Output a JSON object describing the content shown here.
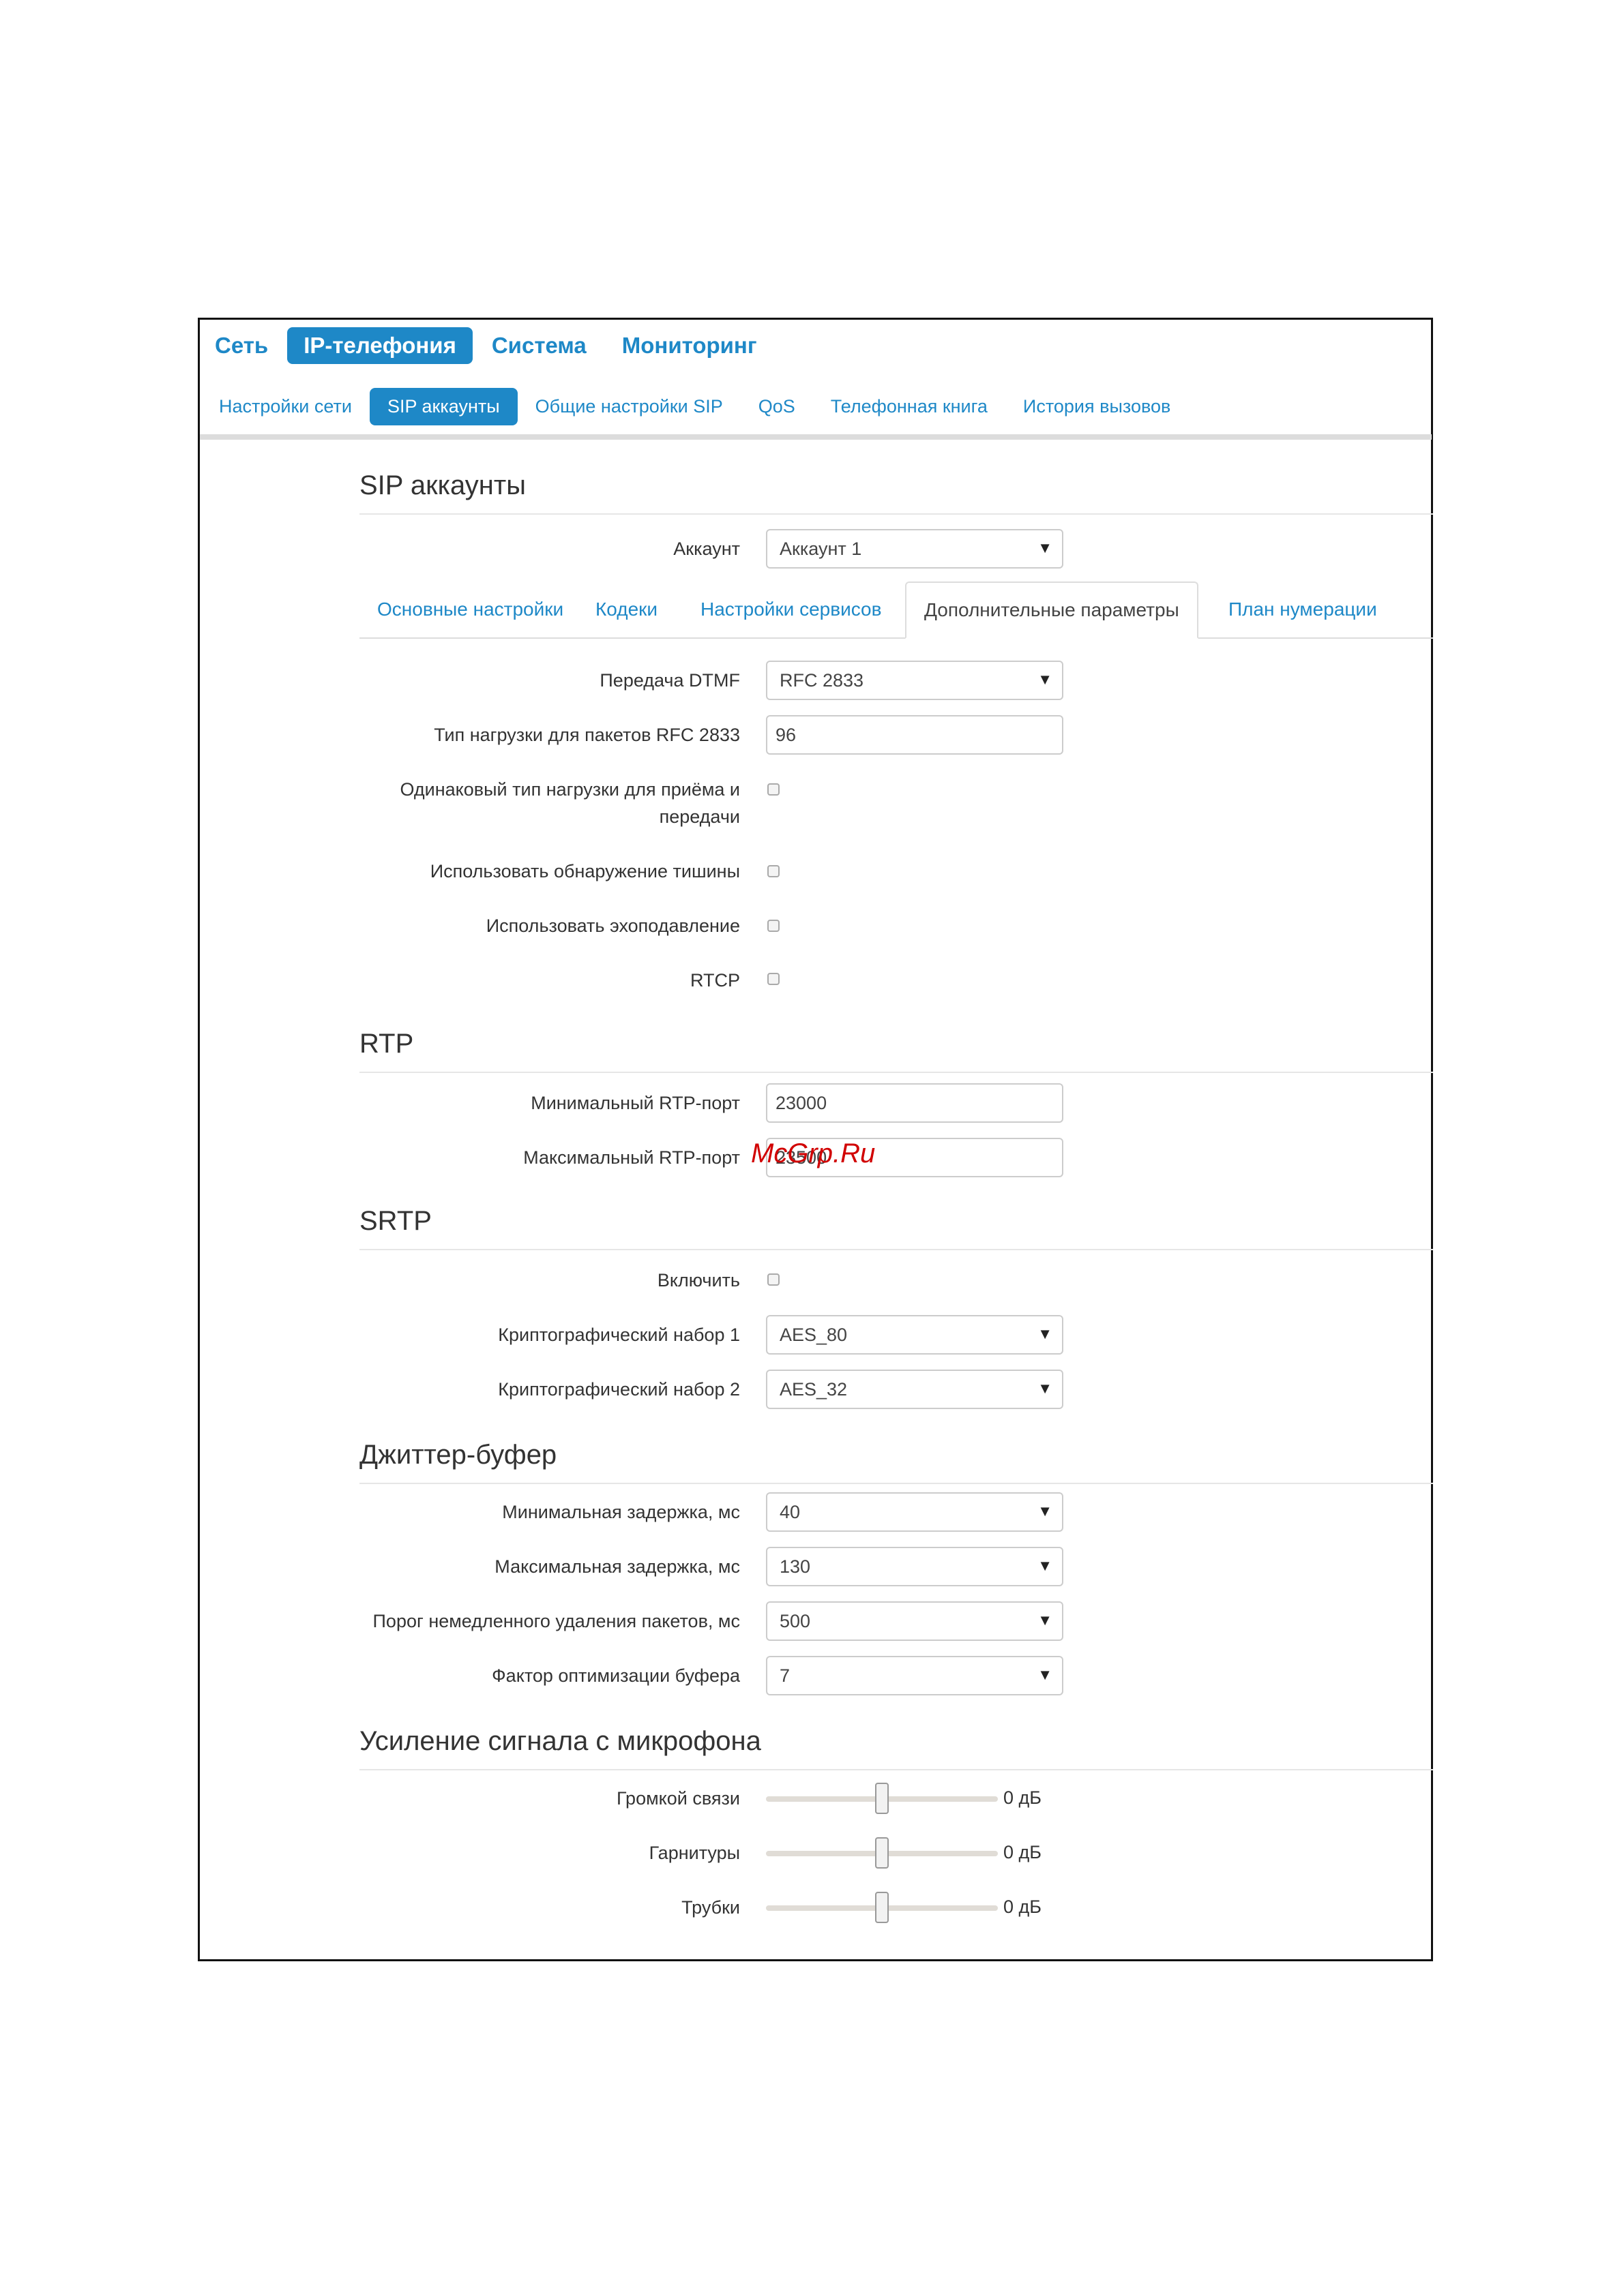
{
  "main_nav": [
    "Сеть",
    "IP-телефония",
    "Система",
    "Мониторинг"
  ],
  "sub_nav": [
    "Настройки сети",
    "SIP аккаунты",
    "Общие настройки SIP",
    "QoS",
    "Телефонная книга",
    "История вызовов"
  ],
  "page_title": "SIP аккаунты",
  "account": {
    "label": "Аккаунт",
    "value": "Аккаунт 1"
  },
  "tabs": [
    "Основные настройки",
    "Кодеки",
    "Настройки сервисов",
    "Дополнительные параметры",
    "План нумерации"
  ],
  "additional": {
    "dtmf": {
      "label": "Передача DTMF",
      "value": "RFC 2833"
    },
    "payload": {
      "label": "Тип нагрузки для пакетов RFC 2833",
      "value": "96"
    },
    "same_payload": {
      "label": "Одинаковый тип нагрузки для приёма и передачи",
      "checked": false
    },
    "vad": {
      "label": "Использовать обнаружение тишины",
      "checked": false
    },
    "echo": {
      "label": "Использовать эхоподавление",
      "checked": false
    },
    "rtcp": {
      "label": "RTCP",
      "checked": false
    }
  },
  "rtp": {
    "title": "RTP",
    "min_port": {
      "label": "Минимальный RTP-порт",
      "value": "23000"
    },
    "max_port": {
      "label": "Максимальный RTP-порт",
      "value": "23500"
    }
  },
  "srtp": {
    "title": "SRTP",
    "enable": {
      "label": "Включить",
      "checked": false
    },
    "crypto1": {
      "label": "Криптографический набор 1",
      "value": "AES_80"
    },
    "crypto2": {
      "label": "Криптографический набор 2",
      "value": "AES_32"
    }
  },
  "jitter": {
    "title": "Джиттер-буфер",
    "min_delay": {
      "label": "Минимальная задержка, мс",
      "value": "40"
    },
    "max_delay": {
      "label": "Максимальная задержка, мс",
      "value": "130"
    },
    "drop_threshold": {
      "label": "Порог немедленного удаления пакетов, мс",
      "value": "500"
    },
    "optimization": {
      "label": "Фактор оптимизации буфера",
      "value": "7"
    }
  },
  "gain": {
    "title": "Усиление сигнала с микрофона",
    "speaker": {
      "label": "Громкой связи",
      "value": "0 дБ",
      "level": 0.5
    },
    "headset": {
      "label": "Гарнитуры",
      "value": "0 дБ",
      "level": 0.5
    },
    "handset": {
      "label": "Трубки",
      "value": "0 дБ",
      "level": 0.5
    }
  },
  "watermark": "McGrp.Ru",
  "caret": "▼"
}
